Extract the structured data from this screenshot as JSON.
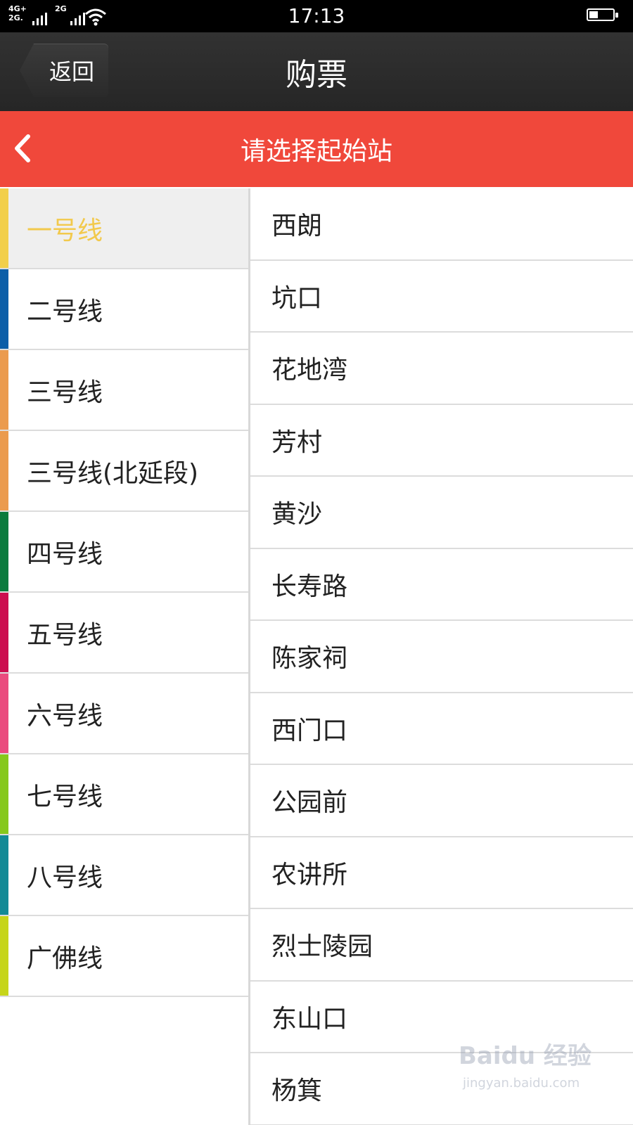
{
  "status_bar": {
    "network_1": "4G+\n2G.",
    "network_2": "2G",
    "time": "17:13"
  },
  "header": {
    "back_label": "返回",
    "title": "购票"
  },
  "sub_header": {
    "title": "请选择起始站"
  },
  "lines": [
    {
      "label": "一号线",
      "color": "#f2cf4a",
      "selected": true
    },
    {
      "label": "二号线",
      "color": "#0b5ea8",
      "selected": false
    },
    {
      "label": "三号线",
      "color": "#eb9b4e",
      "selected": false
    },
    {
      "label": "三号线(北延段)",
      "color": "#eb9b4e",
      "selected": false
    },
    {
      "label": "四号线",
      "color": "#0a7b3d",
      "selected": false
    },
    {
      "label": "五号线",
      "color": "#cc0d4f",
      "selected": false
    },
    {
      "label": "六号线",
      "color": "#ea4b7e",
      "selected": false
    },
    {
      "label": "七号线",
      "color": "#86c81c",
      "selected": false
    },
    {
      "label": "八号线",
      "color": "#138a96",
      "selected": false
    },
    {
      "label": "广佛线",
      "color": "#c6d51a",
      "selected": false
    }
  ],
  "stations": [
    "西朗",
    "坑口",
    "花地湾",
    "芳村",
    "黄沙",
    "长寿路",
    "陈家祠",
    "西门口",
    "公园前",
    "农讲所",
    "烈士陵园",
    "东山口",
    "杨箕"
  ],
  "watermark": {
    "logo_text": "Baidu 经验",
    "url_text": "jingyan.baidu.com"
  },
  "colors": {
    "accent_red": "#f0483b",
    "selected_text": "#f2c94c",
    "header_dark": "#2d2d2d"
  }
}
